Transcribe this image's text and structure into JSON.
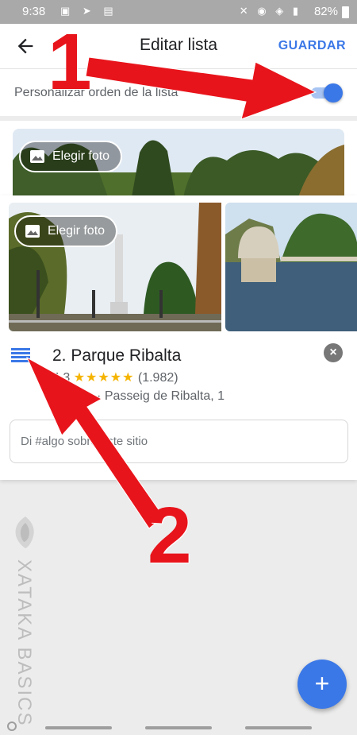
{
  "status_bar": {
    "time": "9:38",
    "battery": "82%"
  },
  "app_bar": {
    "title": "Editar lista",
    "save_label": "GUARDAR"
  },
  "settings": {
    "custom_order_label": "Personalizar orden de la lista",
    "custom_order_enabled": true
  },
  "place_card": {
    "choose_photo_label": "Elegir foto",
    "name": "2. Parque Ribalta",
    "rating": "4,3",
    "stars": "★★★★★",
    "review_count": "(1.982)",
    "category": "Parque",
    "separator": "·",
    "address": "Passeig de Ribalta, 1",
    "note_placeholder": "Di #algo sobre este sitio"
  },
  "first_card": {
    "choose_photo_label": "Elegir foto"
  },
  "fab": {
    "label": "+"
  },
  "watermark": {
    "text": "XATAKA BASICS"
  },
  "annotations": {
    "step1": "1",
    "step2": "2"
  },
  "colors": {
    "accent": "#3b78e7",
    "arrow_red": "#e8141b",
    "star": "#f5b400"
  }
}
